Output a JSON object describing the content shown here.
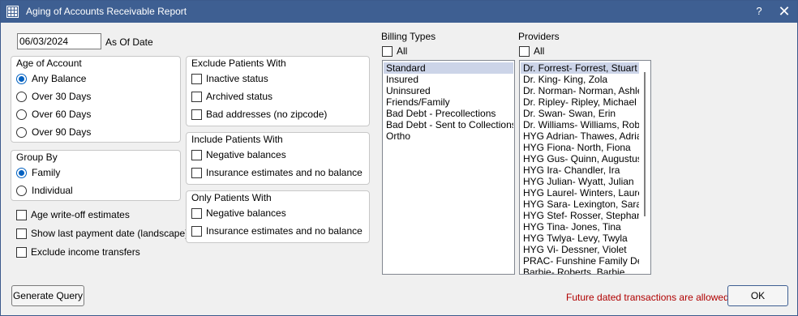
{
  "window": {
    "title": "Aging of Accounts Receivable Report",
    "help_glyph": "?",
    "close_glyph": "✕"
  },
  "as_of_date": {
    "value": "06/03/2024",
    "label": "As Of Date"
  },
  "age_of_account": {
    "title": "Age of Account",
    "options": [
      "Any Balance",
      "Over 30 Days",
      "Over 60 Days",
      "Over 90 Days"
    ],
    "selected": "Any Balance"
  },
  "group_by": {
    "title": "Group By",
    "options": [
      "Family",
      "Individual"
    ],
    "selected": "Family"
  },
  "standalone_checks": [
    "Age write-off estimates",
    "Show last payment date (landscape)",
    "Exclude income transfers"
  ],
  "exclude_patients": {
    "title": "Exclude Patients With",
    "items": [
      "Inactive status",
      "Archived status",
      "Bad addresses (no zipcode)"
    ]
  },
  "include_patients": {
    "title": "Include Patients With",
    "items": [
      "Negative balances",
      "Insurance estimates and no balance"
    ]
  },
  "only_patients": {
    "title": "Only Patients With",
    "items": [
      "Negative balances",
      "Insurance estimates and no balance"
    ]
  },
  "billing_types": {
    "label": "Billing Types",
    "all_label": "All",
    "items": [
      "Standard",
      "Insured",
      "Uninsured",
      "Friends/Family",
      "Bad Debt - Precollections",
      "Bad Debt - Sent to Collections",
      "Ortho"
    ],
    "selected": "Standard"
  },
  "providers": {
    "label": "Providers",
    "all_label": "All",
    "items": [
      "Dr. Forrest- Forrest, Stuart",
      "Dr. King- King, Zola",
      "Dr. Norman- Norman, Ashley",
      "Dr. Ripley- Ripley, Michael",
      "Dr. Swan- Swan, Erin",
      "Dr. Williams- Williams, Robe",
      "HYG Adrian- Thawes, Adrian",
      "HYG Fiona- North, Fiona",
      "HYG Gus- Quinn, Augustus",
      "HYG Ira- Chandler, Ira",
      "HYG Julian- Wyatt, Julian",
      "HYG Laurel- Winters, Laurel",
      "HYG Sara- Lexington, Sara",
      "HYG Stef- Rosser, Stephanie",
      "HYG Tina- Jones, Tina",
      "HYG Twlya- Levy, Twyla",
      "HYG Vi- Dessner, Violet",
      "PRAC- Funshine Family Der",
      "Barbie- Roberts, Barbie"
    ],
    "selected": "Dr. Forrest- Forrest, Stuart"
  },
  "buttons": {
    "generate": "Generate Query",
    "ok": "OK"
  },
  "note": "Future dated transactions are allowed"
}
